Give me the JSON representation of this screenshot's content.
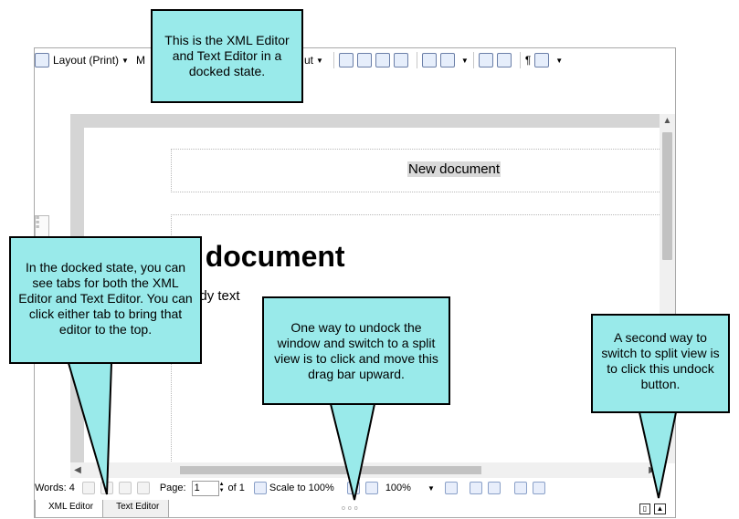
{
  "toolbar": {
    "layout_label": "Layout (Print)",
    "layout_prefix_glyph": "M",
    "extra_label": "ut",
    "pilcrow": "¶"
  },
  "document": {
    "header_text": "New document",
    "title": "New document",
    "body": "Body text"
  },
  "statusbar": {
    "words": "Words: 4",
    "page_label": "Page:",
    "page_value": "1",
    "page_of": "of 1",
    "scale_label": "Scale to 100%",
    "zoom_value": "100%"
  },
  "tabs": [
    "XML Editor",
    "Text Editor"
  ],
  "callouts": {
    "top": "This is the XML Editor and Text Editor in a docked state.",
    "left": "In the docked state, you can see tabs for both the XML Editor and Text Editor. You can click either tab to bring that editor to the top.",
    "middle": "One way to undock the window and switch to a split view is to click and move this drag bar upward.",
    "right": "A second way to switch to split view is to click this undock button."
  },
  "colors": {
    "callout": "#99eaea",
    "canvas": "#d5d5d5"
  }
}
